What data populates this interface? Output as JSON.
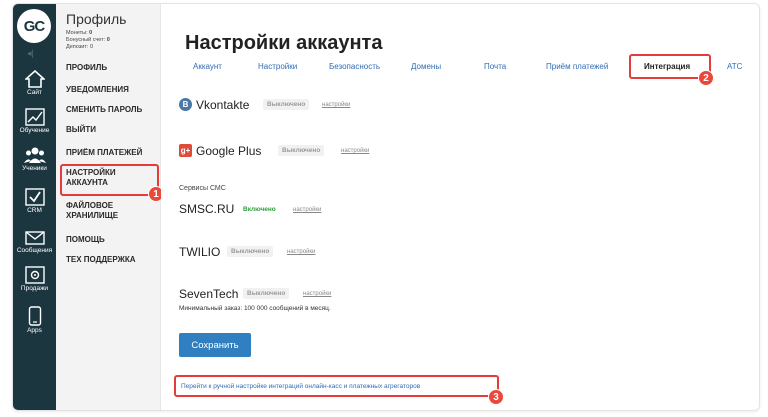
{
  "brand": {
    "logo_text": "GC",
    "collapse_glyph": "◂|"
  },
  "rail": [
    {
      "icon": "home-icon",
      "label": "Сайт"
    },
    {
      "icon": "chart-icon",
      "label": "Обучение"
    },
    {
      "icon": "users-icon",
      "label": "Ученики"
    },
    {
      "icon": "crm-check-icon",
      "label": "CRM"
    },
    {
      "icon": "envelope-icon",
      "label": "Сообщения"
    },
    {
      "icon": "safe-icon",
      "label": "Продажи"
    },
    {
      "icon": "phone-icon",
      "label": "Apps"
    }
  ],
  "profile": {
    "title": "Профиль",
    "coins_label": "Монеты:",
    "coins_value": "0",
    "bonus_label": "Бонусный счет:",
    "bonus_value": "0",
    "deposit_label": "Депозит:",
    "deposit_value": "0"
  },
  "menu": {
    "profile": "Профиль",
    "notifications": "Уведомления",
    "change_password": "Сменить пароль",
    "logout": "Выйти",
    "payments": "Приём платежей",
    "account_settings": "Настройки аккаунта",
    "storage": "Файловое хранилище",
    "help": "Помощь",
    "support": "Тех поддержка"
  },
  "page": {
    "title": "Настройки аккаунта",
    "tabs": [
      "Аккаунт",
      "Настройки",
      "Безопасность",
      "Домены",
      "Почта",
      "Приём платежей",
      "Интеграция",
      "АТС"
    ],
    "active_tab": "Интеграция"
  },
  "integrations": {
    "vk": {
      "icon_glyph": "B",
      "name": "Vkontakte",
      "status": "Выключено",
      "settings": "настройки"
    },
    "google": {
      "icon_glyph": "g+",
      "name": "Google Plus",
      "status": "Выключено",
      "settings": "настройки"
    },
    "sms_label": "Сервисы СМС",
    "smsc": {
      "name": "SMSC.RU",
      "status": "Включено",
      "settings": "настройки"
    },
    "twilio": {
      "name": "TWILIO",
      "status": "Выключено",
      "settings": "настройки"
    },
    "seventech": {
      "name": "SevenTech",
      "status": "Выключено",
      "settings": "настройки",
      "note": "Минимальный заказ: 100 000 сообщений в месяц."
    }
  },
  "actions": {
    "save": "Сохранить",
    "manual_link": "Перейти к ручной настройке интеграций онлайн-касс и платежных агрегаторов"
  },
  "callouts": [
    "1",
    "2",
    "3"
  ],
  "colors": {
    "rail_bg": "#1c3640",
    "highlight": "#e43b3b",
    "accent": "#2f7fc1",
    "status_on": "#2a9d38",
    "vk": "#4a76a8",
    "google": "#dd4b39"
  }
}
